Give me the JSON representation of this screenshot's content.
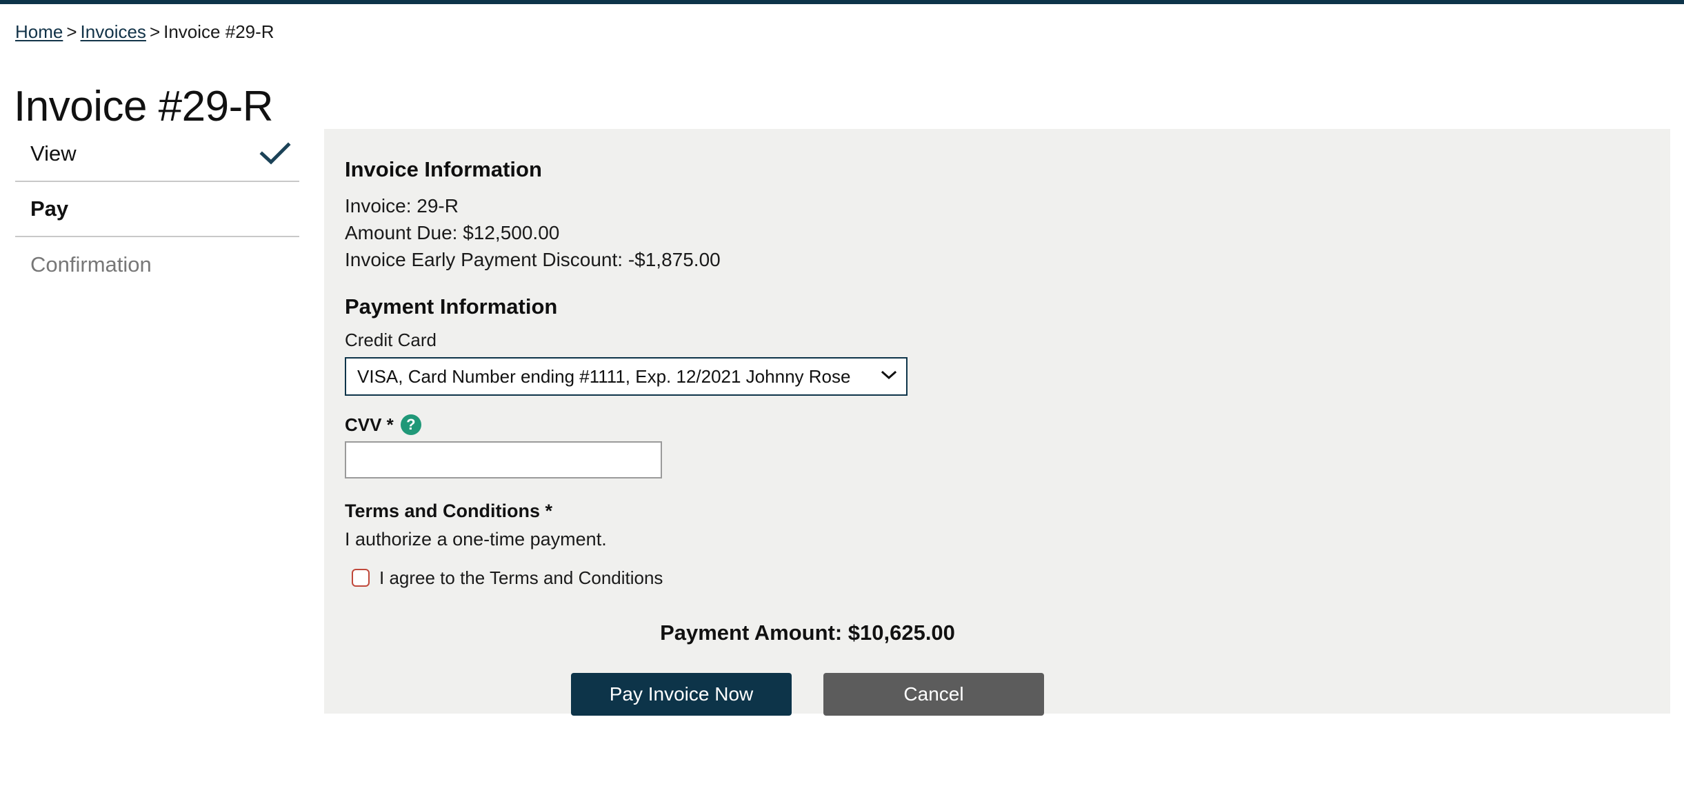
{
  "breadcrumb": {
    "home": "Home",
    "separator": ">",
    "invoices": "Invoices",
    "current": "Invoice #29-R"
  },
  "page_title": "Invoice #29-R",
  "steps": [
    {
      "label": "View",
      "state": "completed",
      "icon": "check-icon"
    },
    {
      "label": "Pay",
      "state": "active"
    },
    {
      "label": "Confirmation",
      "state": "upcoming"
    }
  ],
  "panel": {
    "invoice_information": {
      "heading": "Invoice Information",
      "lines": [
        "Invoice: 29-R",
        "Amount Due: $12,500.00",
        "Invoice Early Payment Discount: -$1,875.00"
      ],
      "invoice_number": "29-R",
      "amount_due": "$12,500.00",
      "early_payment_discount": "-$1,875.00"
    },
    "payment_information": {
      "heading": "Payment Information",
      "credit_card": {
        "label": "Credit Card",
        "selected": "VISA, Card Number ending #1111, Exp. 12/2021 Johnny Rose",
        "options": [
          "VISA, Card Number ending #1111, Exp. 12/2021 Johnny Rose"
        ],
        "chevron": "chevron-down-icon"
      },
      "cvv": {
        "label": "CVV *",
        "value": "",
        "placeholder": "",
        "help_icon": "help-circle-icon"
      }
    },
    "terms": {
      "heading": "Terms and Conditions *",
      "description": "I authorize a one-time payment.",
      "agree_label": "I agree to the Terms and Conditions",
      "agree_checked": false
    },
    "payment_amount_text": "Payment Amount: $10,625.00",
    "payment_amount_value": "$10,625.00",
    "buttons": {
      "pay": "Pay Invoice Now",
      "cancel": "Cancel"
    }
  },
  "colors": {
    "accent_navy": "#0d3449",
    "panel_bg": "#f0f0ee",
    "help_green": "#209878",
    "checkbox_red": "#c0483a",
    "cancel_gray": "#5c5c5c",
    "muted_text": "#777777"
  }
}
